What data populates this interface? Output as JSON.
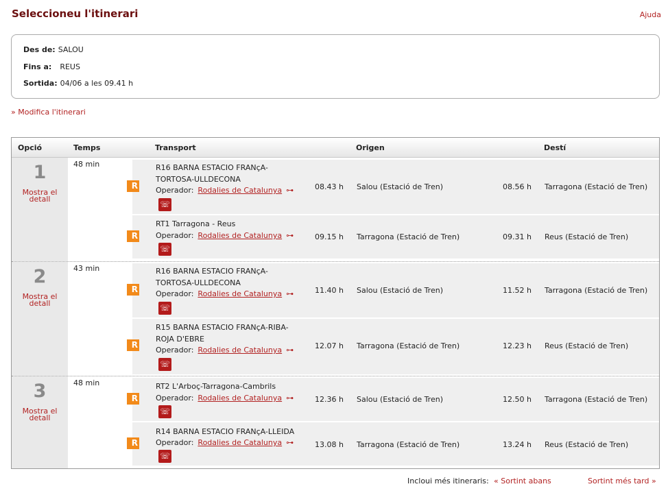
{
  "header": {
    "title": "Seleccioneu l'itinerari",
    "help": "Ajuda"
  },
  "summary": {
    "from_label": "Des de:",
    "from": "SALOU",
    "to_label": "Fins a:",
    "to": "REUS",
    "departure_label": "Sortida:",
    "departure": "04/06 a les 09.41 h"
  },
  "modify_link": "» Modifica l'itinerari",
  "table": {
    "headers": {
      "option": "Opció",
      "time": "Temps",
      "transport": "Transport",
      "origin": "Origen",
      "destination": "Destí"
    },
    "show_detail": "Mostra el detall",
    "operator_label": "Operador:",
    "icons": {
      "rail": "R",
      "phone": "☏",
      "arrow": "⊶"
    },
    "options": [
      {
        "num": "1",
        "duration": "48 min",
        "legs": [
          {
            "line": "R16 BARNA ESTACIO FRANçA-TORTOSA-ULLDECONA",
            "operator": "Rodalies de Catalunya",
            "dep": "08.43 h",
            "origin": "Salou (Estació de Tren)",
            "arr": "08.56 h",
            "dest": "Tarragona (Estació de Tren)"
          },
          {
            "line": "RT1 Tarragona - Reus",
            "operator": "Rodalies de Catalunya",
            "dep": "09.15 h",
            "origin": "Tarragona (Estació de Tren)",
            "arr": "09.31 h",
            "dest": "Reus (Estació de Tren)"
          }
        ]
      },
      {
        "num": "2",
        "duration": "43 min",
        "legs": [
          {
            "line": "R16 BARNA ESTACIO FRANçA-TORTOSA-ULLDECONA",
            "operator": "Rodalies de Catalunya",
            "dep": "11.40 h",
            "origin": "Salou (Estació de Tren)",
            "arr": "11.52 h",
            "dest": "Tarragona (Estació de Tren)"
          },
          {
            "line": "R15 BARNA ESTACIO FRANçA-RIBA-ROJA D'EBRE",
            "operator": "Rodalies de Catalunya",
            "dep": "12.07 h",
            "origin": "Tarragona (Estació de Tren)",
            "arr": "12.23 h",
            "dest": "Reus (Estació de Tren)"
          }
        ]
      },
      {
        "num": "3",
        "duration": "48 min",
        "legs": [
          {
            "line": "RT2 L'Arboç-Tarragona-Cambrils",
            "operator": "Rodalies de Catalunya",
            "dep": "12.36 h",
            "origin": "Salou (Estació de Tren)",
            "arr": "12.50 h",
            "dest": "Tarragona (Estació de Tren)"
          },
          {
            "line": "R14 BARNA ESTACIO FRANçA-LLEIDA",
            "operator": "Rodalies de Catalunya",
            "dep": "13.08 h",
            "origin": "Tarragona (Estació de Tren)",
            "arr": "13.24 h",
            "dest": "Reus (Estació de Tren)"
          }
        ]
      }
    ]
  },
  "footer": {
    "more_label": "Incloui més itineraris:",
    "earlier": "« Sortint abans",
    "later": "Sortint més tard »"
  }
}
